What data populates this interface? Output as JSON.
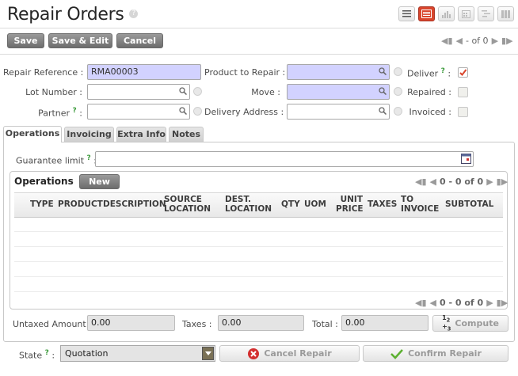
{
  "page": {
    "title": "Repair Orders",
    "help": "?"
  },
  "toolbar": {
    "save": "Save",
    "save_edit": "Save & Edit",
    "cancel": "Cancel"
  },
  "pager": {
    "text": "- of 0"
  },
  "form": {
    "repair_reference_label": "Repair Reference :",
    "repair_reference_value": "RMA00003",
    "product_label": "Product to Repair :",
    "deliver_label": "Deliver",
    "deliver_suffix": ":",
    "lot_label": "Lot Number :",
    "move_label": "Move :",
    "repaired_label": "Repaired :",
    "partner_label": "Partner",
    "partner_suffix": ":",
    "delivery_address_label": "Delivery Address :",
    "invoiced_label": "Invoiced :"
  },
  "tabs": [
    "Operations",
    "Invoicing",
    "Extra Info",
    "Notes"
  ],
  "operations_tab": {
    "guarantee_label": "Guarantee limit",
    "guarantee_suffix": ":",
    "grid_title": "Operations",
    "new_button": "New",
    "pager": "0 - 0 of 0",
    "columns": [
      "TYPE",
      "PRODUCT",
      "DESCRIPTION",
      "SOURCE LOCATION",
      "DEST. LOCATION",
      "QTY",
      "UOM",
      "UNIT PRICE",
      "TAXES",
      "TO INVOICE",
      "SUBTOTAL"
    ]
  },
  "totals": {
    "untaxed_label": "Untaxed Amount :",
    "untaxed_value": "0.00",
    "taxes_label": "Taxes :",
    "taxes_value": "0.00",
    "total_label": "Total :",
    "total_value": "0.00",
    "compute_button": "Compute"
  },
  "footer": {
    "state_label": "State",
    "state_suffix": ":",
    "state_value": "Quotation",
    "cancel_repair": "Cancel Repair",
    "confirm_repair": "Confirm Repair"
  },
  "colors": {
    "required_field": "#d2d2ff",
    "accent": "#d9452c"
  },
  "icons": [
    "help-icon",
    "list-view-icon",
    "form-view-icon",
    "graph-view-icon",
    "calendar-view-icon",
    "gantt-view-icon",
    "kanban-view-icon",
    "search-icon",
    "chevron-down-icon",
    "first-page-icon",
    "prev-page-icon",
    "next-page-icon",
    "last-page-icon",
    "calendar-icon",
    "cancel-icon",
    "check-icon",
    "compute-icon"
  ]
}
